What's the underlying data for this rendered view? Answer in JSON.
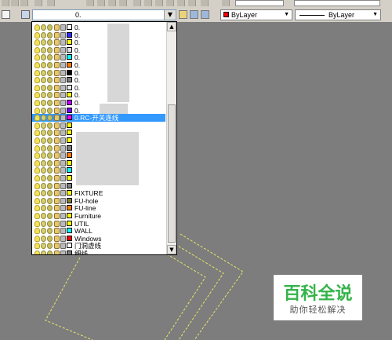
{
  "layer_control": {
    "current_value": "0.",
    "arrow": "▼"
  },
  "color_control": {
    "value": "ByLayer",
    "arrow": "▼"
  },
  "linetype_control": {
    "value": "ByLayer",
    "arrow": "▼"
  },
  "layers": [
    {
      "name": "0.",
      "color": "#ffffff"
    },
    {
      "name": "0.",
      "color": "#2d2dff"
    },
    {
      "name": "0.",
      "color": "#ffff00"
    },
    {
      "name": "0.",
      "color": "#e0e0e0"
    },
    {
      "name": "0.",
      "color": "#00ffff"
    },
    {
      "name": "0.",
      "color": "#ff7f00"
    },
    {
      "name": "0.",
      "color": "#000000"
    },
    {
      "name": "0.",
      "color": "#808080"
    },
    {
      "name": "0.",
      "color": "#e8e8e8"
    },
    {
      "name": "0.",
      "color": "#ffff00"
    },
    {
      "name": "0.",
      "color": "#c000ff"
    },
    {
      "name": "0.",
      "color": "#8000ff"
    },
    {
      "name": "0.RC-开关连线",
      "color": "#ff00ff"
    },
    {
      "name": "",
      "color": "#ffff00"
    },
    {
      "name": "",
      "color": "#ffff00"
    },
    {
      "name": "",
      "color": "#ffff00"
    },
    {
      "name": "",
      "color": "#808080"
    },
    {
      "name": "",
      "color": "#ff7f00"
    },
    {
      "name": "",
      "color": "#ffff00"
    },
    {
      "name": "",
      "color": "#00ffff"
    },
    {
      "name": "",
      "color": "#ffff00"
    },
    {
      "name": "",
      "color": "#808080"
    },
    {
      "name": "FIXTURE",
      "color": "#ffff00"
    },
    {
      "name": "FU-hole",
      "color": "#808040"
    },
    {
      "name": "FU-line",
      "color": "#ff7f00"
    },
    {
      "name": "Furniture",
      "color": "#ffff00"
    },
    {
      "name": "UTIL",
      "color": "#ffff00"
    },
    {
      "name": "WALL",
      "color": "#00ffff"
    },
    {
      "name": "Windows",
      "color": "#ff0000"
    },
    {
      "name": "门洞虚线",
      "color": "#ffffff"
    },
    {
      "name": "细线",
      "color": "#808080"
    }
  ],
  "selected_index": 12,
  "watermark": {
    "title": "百科全说",
    "subtitle": "助你轻松解决"
  }
}
